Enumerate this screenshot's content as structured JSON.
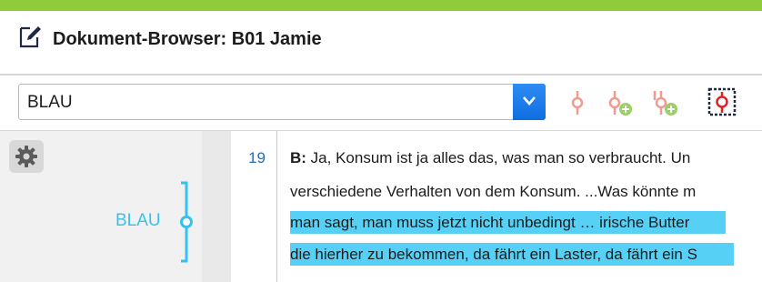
{
  "window": {
    "title": "Dokument-Browser: B01 Jamie",
    "accent_color": "#8ecc3a"
  },
  "toolbar": {
    "code_select_value": "BLAU",
    "icons": [
      "code-stripe-icon",
      "add-code-stripe-icon",
      "add-multi-code-icon",
      "code-selection-icon"
    ]
  },
  "left_panel": {
    "code_label": "BLAU",
    "code_color": "#33c3f0"
  },
  "document": {
    "paragraph_number": "19",
    "speaker": "B:",
    "lines": [
      {
        "text": " Ja, Konsum ist ja alles das, was man so verbraucht. Un",
        "highlighted": false
      },
      {
        "text": "verschiedene Verhalten von dem Konsum. ...Was könnte m",
        "highlighted": false
      },
      {
        "text": "man sagt, man muss jetzt nicht unbedingt … irische Butter",
        "highlighted": true
      },
      {
        "text": "die hierher zu bekommen, da fährt ein Laster, da fährt ein S",
        "highlighted": true
      }
    ],
    "highlight_color": "#56d0f5"
  }
}
